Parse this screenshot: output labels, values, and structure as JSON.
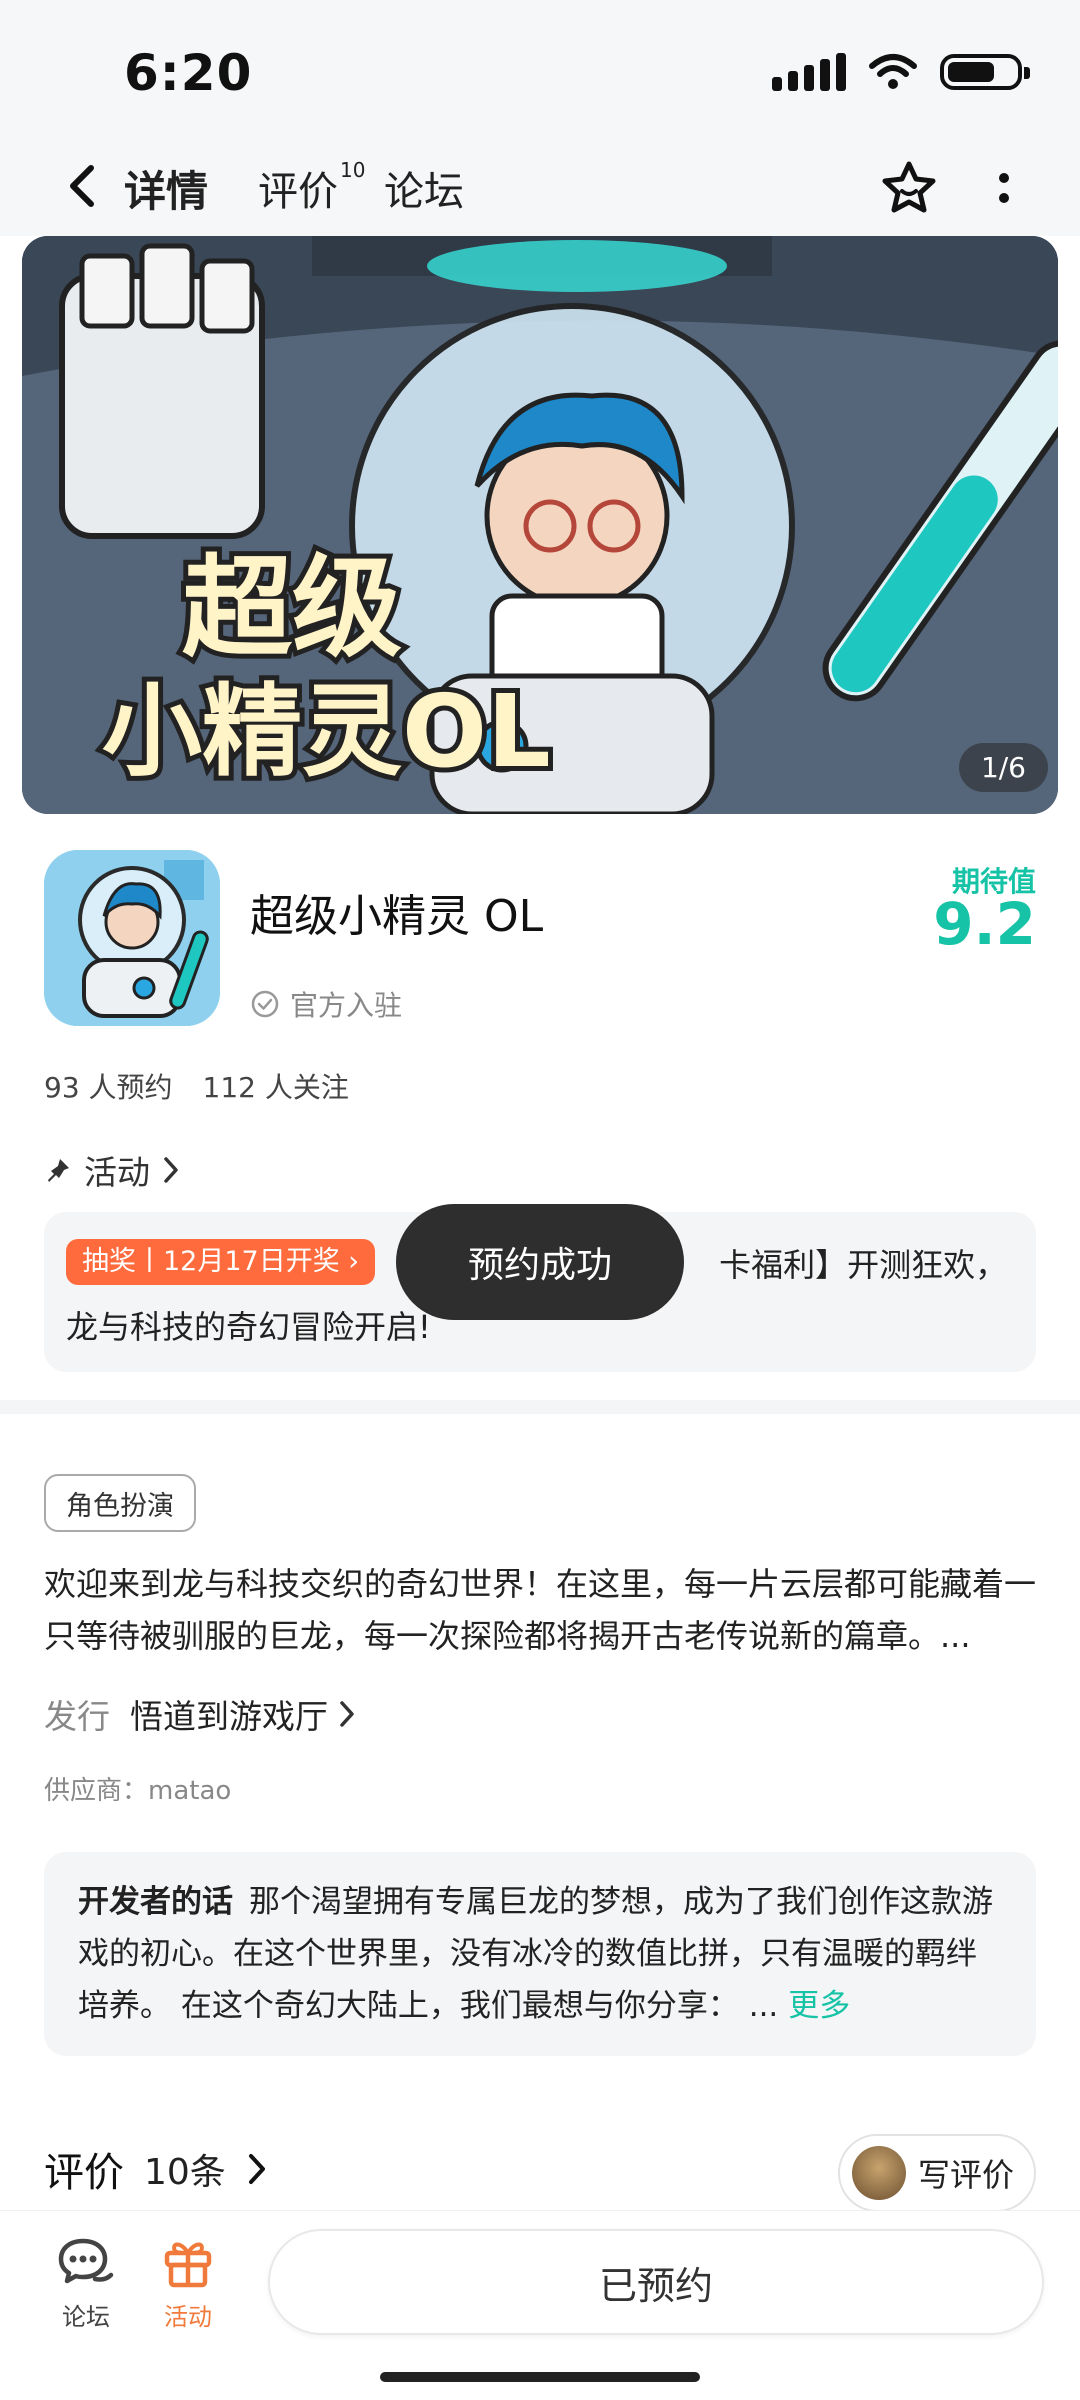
{
  "status_bar": {
    "time": "6:20"
  },
  "nav": {
    "tabs": [
      {
        "label": "详情"
      },
      {
        "label": "评价",
        "badge": "10"
      },
      {
        "label": "论坛"
      }
    ]
  },
  "banner": {
    "counter": "1/6"
  },
  "app": {
    "name": "超级小精灵 OL",
    "official": "官方入驻",
    "expect_label": "期待值",
    "expect_value": "9.2",
    "reservations": "93 人预约",
    "followers": "112 人关注"
  },
  "activity": {
    "header": "活动",
    "badge": "抽奖丨12月17日开奖",
    "text_before_toast": "【",
    "text": "卡福利】开测狂欢，龙与科技的奇幻冒险开启!",
    "toast": "预约成功"
  },
  "details": {
    "genre_tag": "角色扮演",
    "description": "欢迎来到龙与科技交织的奇幻世界！在这里，每一片云层都可能藏着一只等待被驯服的巨龙，每一次探险都将揭开古老传说新的篇章。...",
    "publisher_label": "发行",
    "publisher_value": "悟道到游戏厅",
    "supplier": "供应商：matao"
  },
  "developer": {
    "title": "开发者的话",
    "text": "那个渴望拥有专属巨龙的梦想，成为了我们创作这款游戏的初心。在这个世界里，没有冰冷的数值比拼，只有温暖的羁绊培养。 在这个奇幻大陆上，我们最想与你分享：",
    "ellipsis": "...",
    "more": "更多"
  },
  "reviews": {
    "title": "评价",
    "count": "10条",
    "write": "写评价"
  },
  "bottom_bar": {
    "forum": "论坛",
    "activity": "活动",
    "reserved": "已预约"
  },
  "colors": {
    "accent": "#17c3a6",
    "orange": "#ff6b3d",
    "toast_bg": "#2e2e2e"
  }
}
